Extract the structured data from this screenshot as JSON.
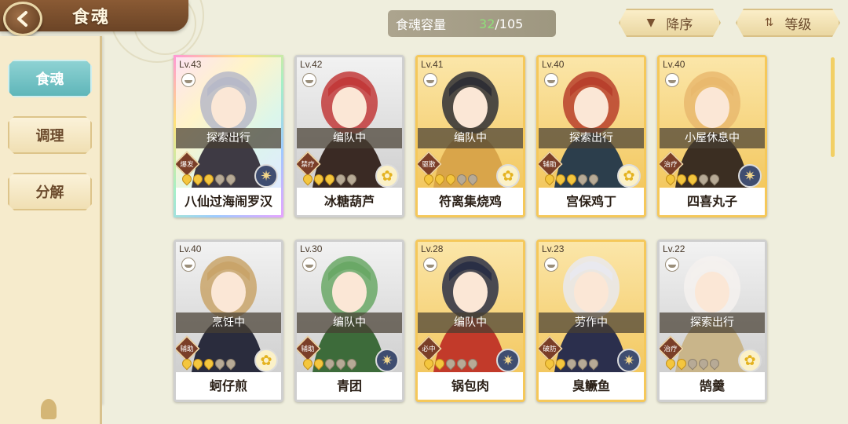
{
  "header": {
    "title": "食魂",
    "capacity_label": "食魂容量",
    "capacity_current": "32",
    "capacity_max": "/105",
    "sort_order": "降序",
    "sort_key": "等级"
  },
  "sidebar": {
    "tabs": [
      {
        "label": "食魂",
        "active": true
      },
      {
        "label": "调理",
        "active": false
      },
      {
        "label": "分解",
        "active": false
      }
    ]
  },
  "cards": [
    {
      "level": "Lv.43",
      "status": "探索出行",
      "role": "爆发",
      "stars": 3,
      "element": "gear-icon",
      "name": "八仙过海闹罗汉",
      "frame": "rainbow",
      "palette": [
        "#d9d6e3",
        "#b7b9c8",
        "#3e3a44"
      ]
    },
    {
      "level": "Lv.42",
      "status": "编队中",
      "role": "禁疗",
      "stars": 3,
      "element": "flower-icon",
      "name": "冰糖葫芦",
      "frame": "silver",
      "palette": [
        "#f3d3cf",
        "#c23a3a",
        "#3a2a24"
      ]
    },
    {
      "level": "Lv.41",
      "status": "编队中",
      "role": "驱散",
      "stars": 3,
      "element": "flower-icon",
      "name": "符离集烧鸡",
      "frame": "gold",
      "palette": [
        "#f4e6c8",
        "#2f2f35",
        "#d9a54a"
      ]
    },
    {
      "level": "Lv.40",
      "status": "探索出行",
      "role": "辅助",
      "stars": 3,
      "element": "flower-icon",
      "name": "宫保鸡丁",
      "frame": "gold",
      "palette": [
        "#f1d7a3",
        "#b8402c",
        "#2c3e4c"
      ]
    },
    {
      "level": "Lv.40",
      "status": "小屋休息中",
      "role": "治疗",
      "stars": 3,
      "element": "gear-icon",
      "name": "四喜丸子",
      "frame": "gold",
      "palette": [
        "#f4e2b9",
        "#e9b96e",
        "#3b2e22"
      ]
    },
    {
      "level": "Lv.40",
      "status": "烹饪中",
      "role": "辅助",
      "stars": 3,
      "element": "flower-icon",
      "name": "蚵仔煎",
      "frame": "silver",
      "palette": [
        "#e8e3da",
        "#c9a46a",
        "#2a2c3d"
      ]
    },
    {
      "level": "Lv.30",
      "status": "编队中",
      "role": "辅助",
      "stars": 2,
      "element": "gear-icon",
      "name": "青团",
      "frame": "silver",
      "palette": [
        "#f3ead1",
        "#6aa866",
        "#3d6b3a"
      ]
    },
    {
      "level": "Lv.28",
      "status": "编队中",
      "role": "必中",
      "stars": 2,
      "element": "gear-icon",
      "name": "锅包肉",
      "frame": "gold",
      "palette": [
        "#f7ebcb",
        "#2a2f45",
        "#c23a2a"
      ]
    },
    {
      "level": "Lv.23",
      "status": "劳作中",
      "role": "破防",
      "stars": 2,
      "element": "gear-icon",
      "name": "臭鳜鱼",
      "frame": "gold",
      "palette": [
        "#f5e6c2",
        "#e9e9ef",
        "#2b2f4d"
      ]
    },
    {
      "level": "Lv.22",
      "status": "探索出行",
      "role": "治疗",
      "stars": 2,
      "element": "flower-icon",
      "name": "鹄羹",
      "frame": "silver",
      "palette": [
        "#ece8e2",
        "#f4f1ee",
        "#c9b58a"
      ]
    }
  ]
}
